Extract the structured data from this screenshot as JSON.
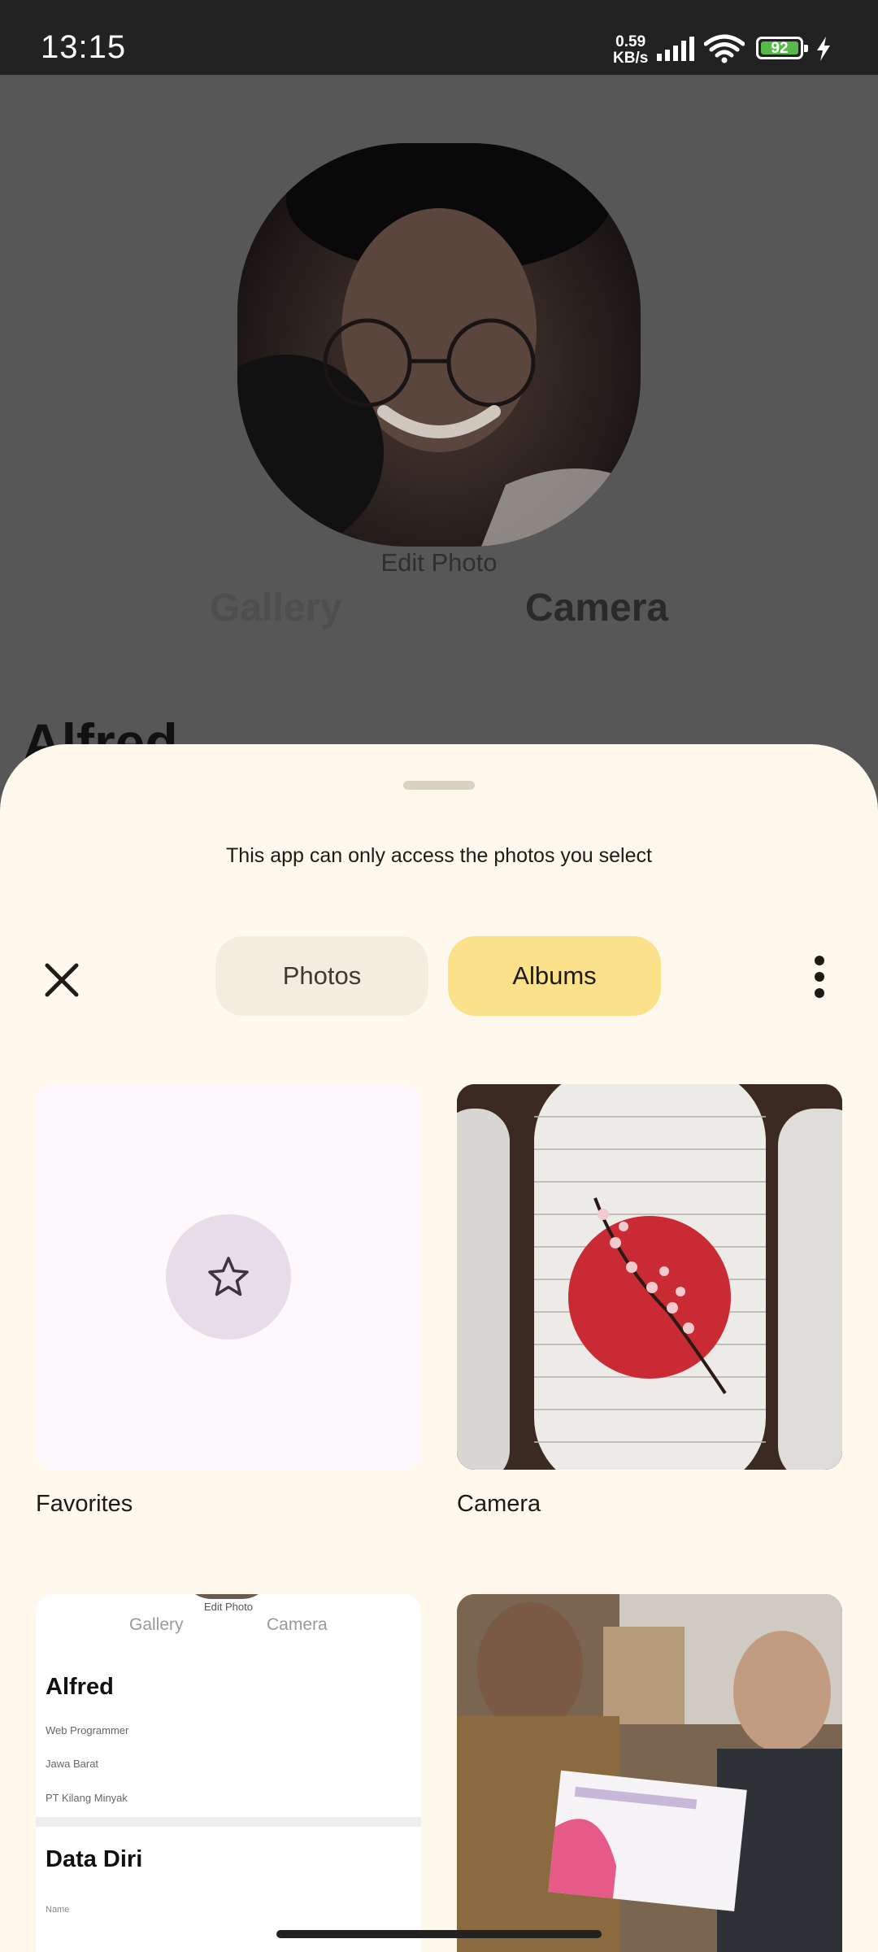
{
  "status_bar": {
    "time": "13:15",
    "net_speed_value": "0.59",
    "net_speed_unit": "KB/s",
    "battery": "92"
  },
  "background_app": {
    "edit_photo": "Edit Photo",
    "tab_gallery": "Gallery",
    "tab_camera": "Camera",
    "name": "Alfred"
  },
  "sheet": {
    "notice": "This app can only access the photos you select",
    "tabs": [
      {
        "label": "Photos",
        "selected": false
      },
      {
        "label": "Albums",
        "selected": true
      }
    ],
    "albums": [
      {
        "label": "Favorites",
        "icon": "star-icon"
      },
      {
        "label": "Camera",
        "icon": "lantern-photo"
      },
      {
        "label": "",
        "icon": "screenshot-thumbnail"
      },
      {
        "label": "",
        "icon": "people-photo"
      }
    ],
    "screenshot_thumb": {
      "edit_photo": "Edit Photo",
      "gallery": "Gallery",
      "camera": "Camera",
      "name": "Alfred",
      "line1": "Web Programmer",
      "line2": "Jawa Barat",
      "line3": "PT Kilang Minyak",
      "section": "Data Diri",
      "field": "Name"
    }
  },
  "colors": {
    "sheet_bg": "#fff8ec",
    "selected_tab": "#fbe18a",
    "unselected_tab": "#f4ecdf",
    "battery_fill": "#57b94a"
  }
}
